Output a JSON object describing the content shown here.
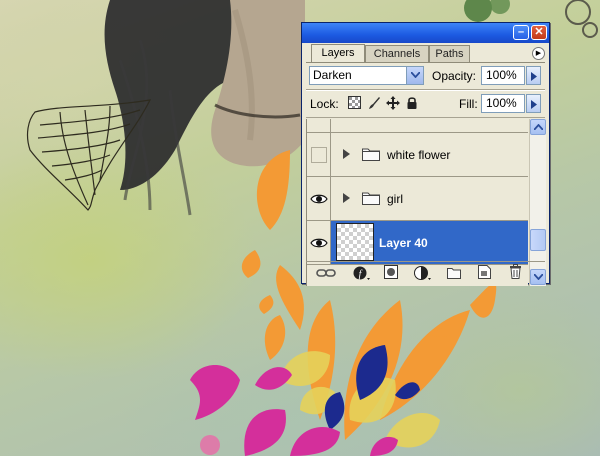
{
  "window": {
    "minimize_glyph": "–",
    "close_glyph": "✕"
  },
  "tabs": [
    {
      "label": "Layers",
      "active": true
    },
    {
      "label": "Channels",
      "active": false
    },
    {
      "label": "Paths",
      "active": false
    }
  ],
  "palette_menu_icon": "triangle-right-icon",
  "blend_mode": {
    "value": "Darken"
  },
  "opacity": {
    "label": "Opacity:",
    "value": "100%"
  },
  "lock": {
    "label": "Lock:",
    "icons": [
      "lock-transparent-icon",
      "lock-image-icon",
      "lock-position-icon",
      "lock-all-icon"
    ]
  },
  "fill": {
    "label": "Fill:",
    "value": "100%"
  },
  "layers": [
    {
      "name": "",
      "visible": false,
      "type": "partial"
    },
    {
      "name": "white flower",
      "visible": false,
      "type": "group"
    },
    {
      "name": "girl",
      "visible": true,
      "type": "group"
    },
    {
      "name": "Layer 40",
      "visible": true,
      "type": "layer",
      "selected": true
    }
  ],
  "bottom_icons": [
    "link-layers-icon",
    "layer-style-icon",
    "add-mask-icon",
    "adjustment-layer-icon",
    "new-group-icon",
    "new-layer-icon",
    "delete-layer-icon"
  ],
  "colors": {
    "accent": "#3168c8",
    "panel": "#ece9d8",
    "titlebar": "#2a6ae8",
    "orange_swirl": "#f39a35",
    "magenta": "#d42f9b",
    "navy": "#1c2a8e",
    "yellow": "#e6d25a"
  }
}
